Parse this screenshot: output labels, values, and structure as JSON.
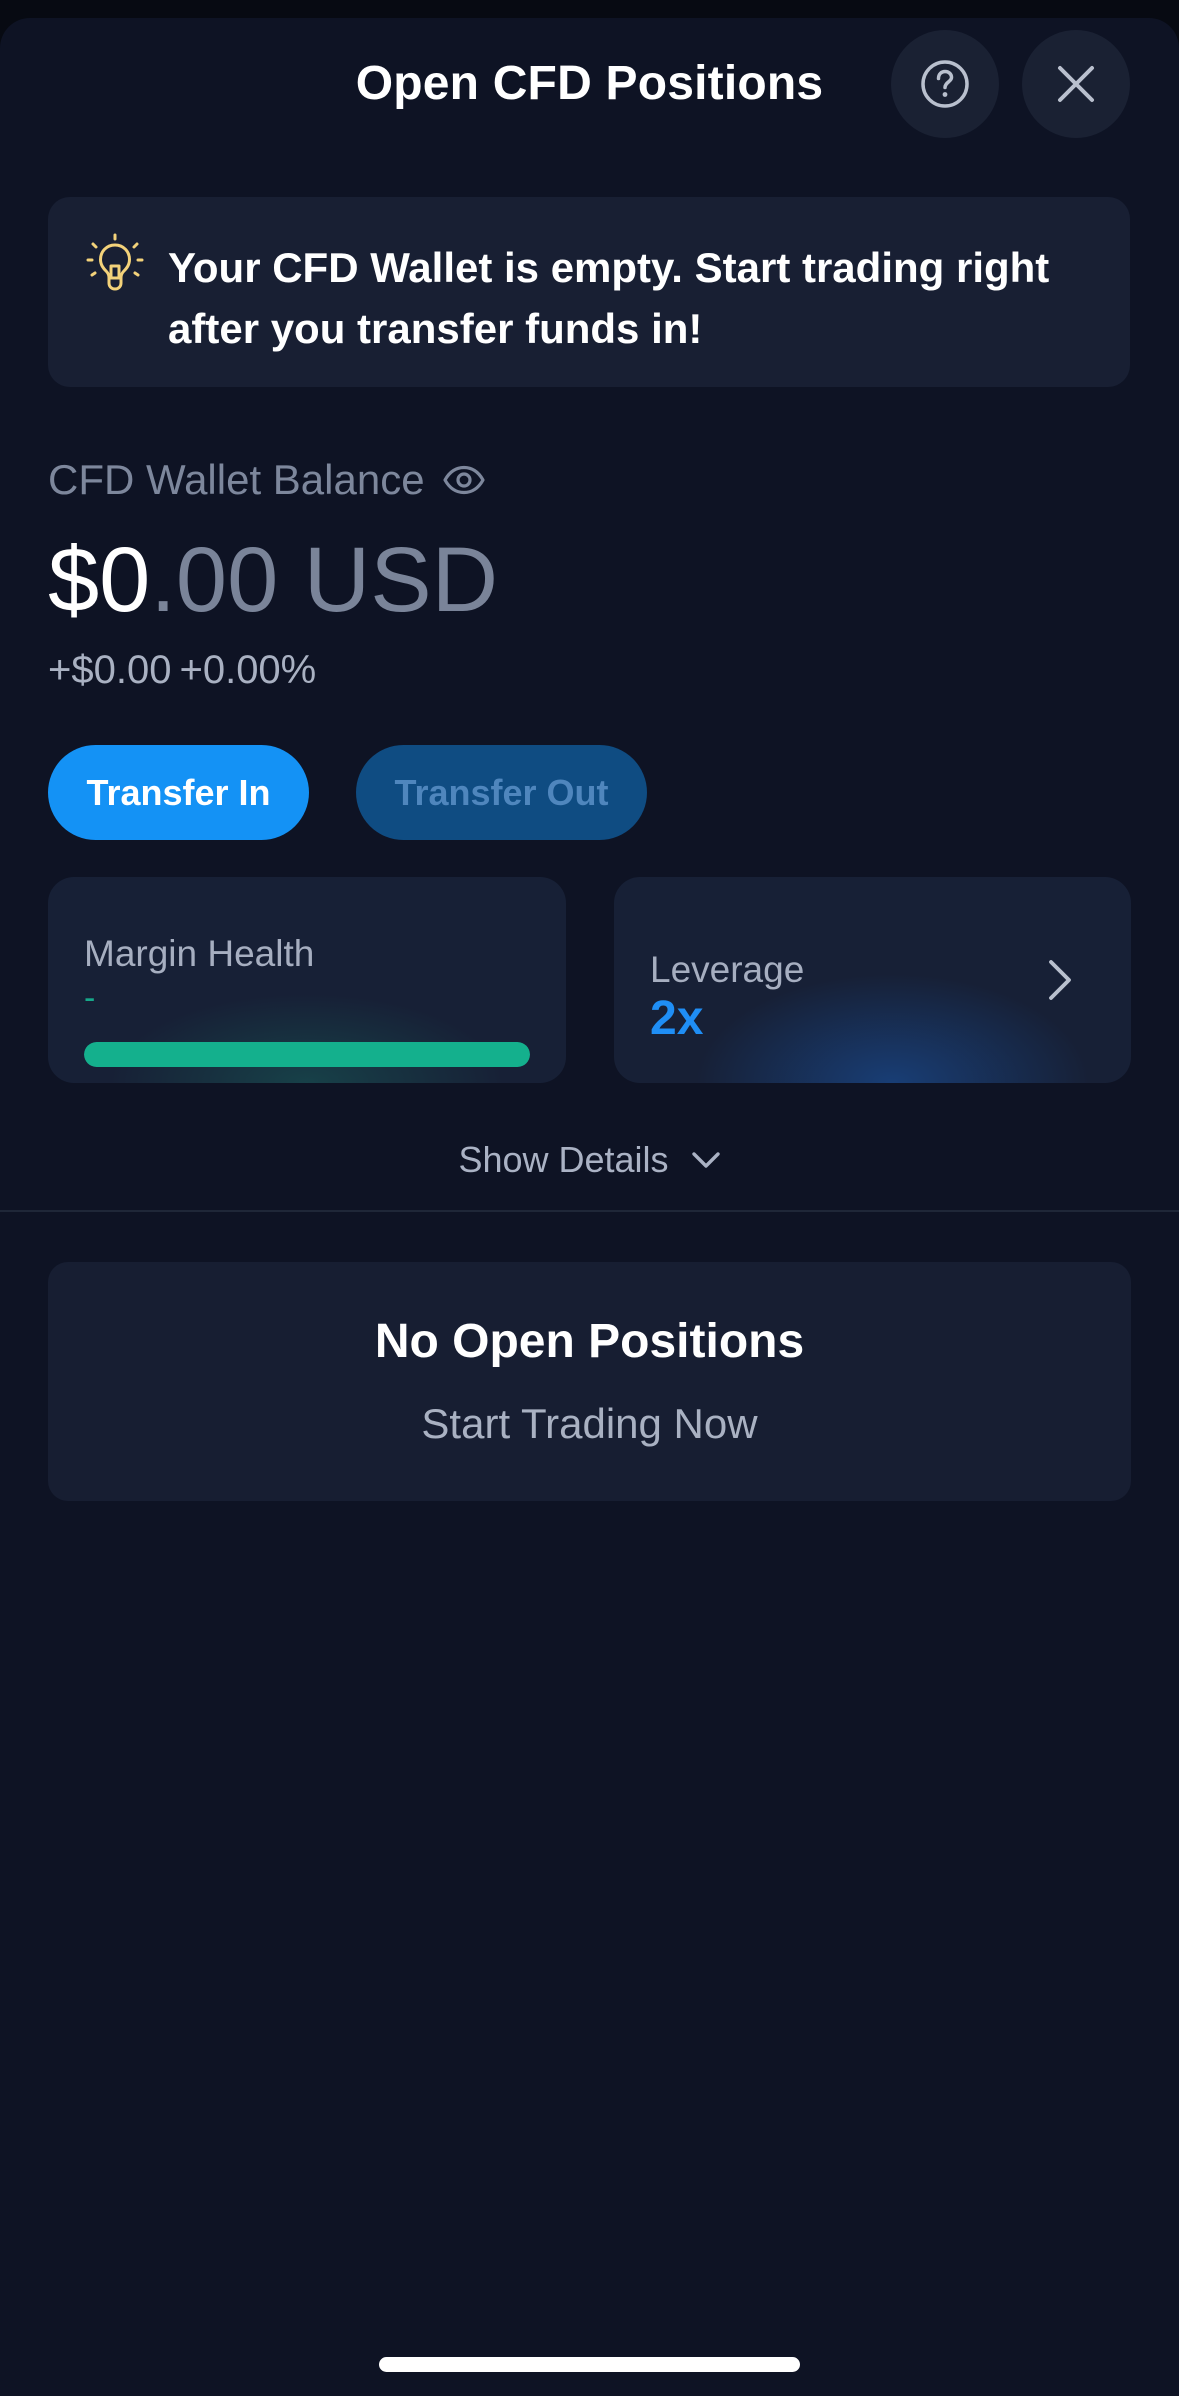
{
  "header": {
    "title": "Open CFD Positions",
    "help_icon": "question-circle-icon",
    "close_icon": "close-x-icon"
  },
  "notice": {
    "icon": "lightbulb-icon",
    "text": "Your CFD Wallet is empty. Start trading right after you transfer funds in!"
  },
  "balance": {
    "label": "CFD Wallet Balance",
    "visibility_icon": "eye-icon",
    "amount_main": "$0",
    "amount_rest": ".00 USD",
    "pnl_amount": "+$0.00",
    "pnl_percent": "+0.00%"
  },
  "actions": {
    "transfer_in": "Transfer In",
    "transfer_out": "Transfer Out"
  },
  "margin": {
    "label": "Margin Health",
    "value": "-",
    "fill_fraction": 1.0
  },
  "leverage": {
    "label": "Leverage",
    "value": "2x",
    "chevron_icon": "chevron-right-icon"
  },
  "details": {
    "label": "Show Details",
    "chevron_icon": "chevron-down-icon"
  },
  "positions": {
    "empty_title": "No Open Positions",
    "empty_cta": "Start Trading Now"
  },
  "colors": {
    "background": "#0e1324",
    "accent": "#1492f5",
    "health": "#14b08d",
    "notice_icon": "#f3d27a"
  }
}
